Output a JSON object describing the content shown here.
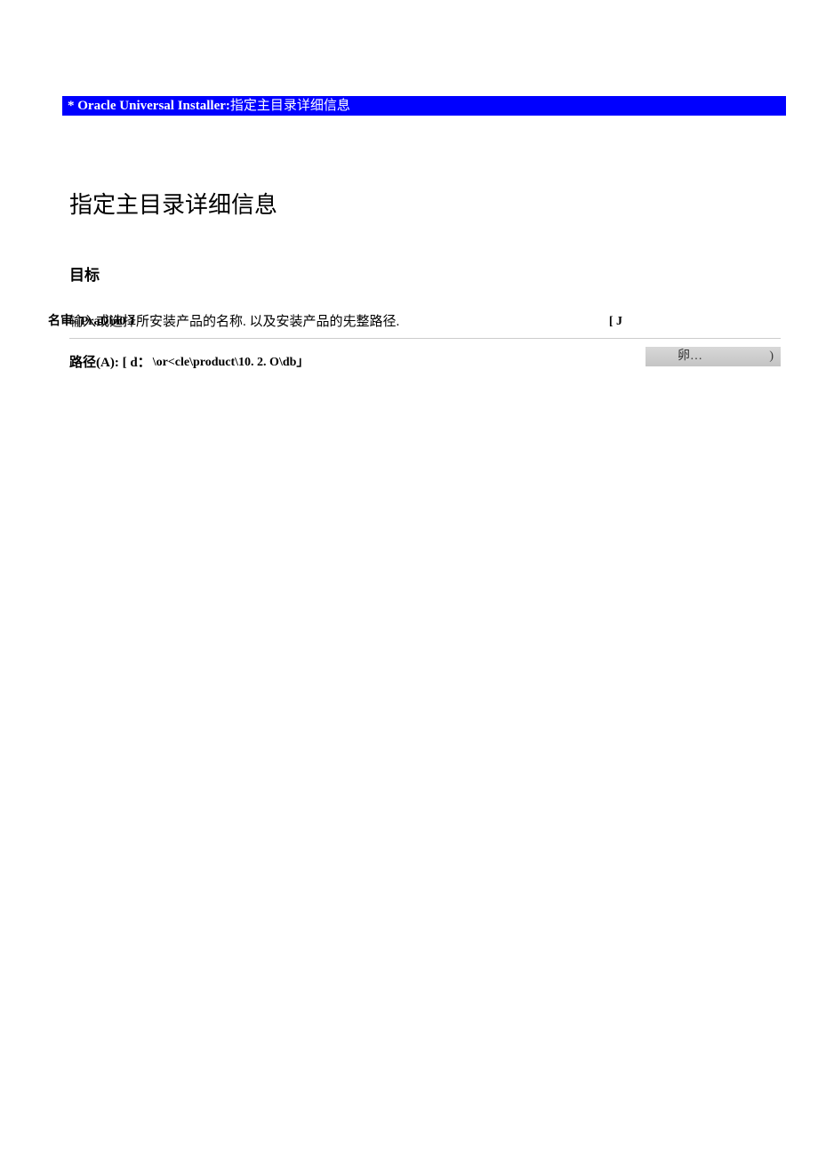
{
  "titlebar": {
    "prefix": "* Oracle Universal Installer:",
    "suffix": "指定主目录详细信息"
  },
  "main": {
    "heading": "指定主目录详细信息",
    "section": "目标",
    "instruction": "输入或选择所安装产品的名称. 以及安装产品的兂整路径."
  },
  "name_row": {
    "label": "名审-",
    "value": "|PraDbl0 J",
    "suffix": "[ J"
  },
  "path_row": {
    "label_zh": "路径",
    "label_en": "(A): [",
    "drive": "d：",
    "value": "\\or<cle\\product\\10. 2. O\\db」"
  },
  "browse": {
    "label": "卵…",
    "paren": ")"
  }
}
